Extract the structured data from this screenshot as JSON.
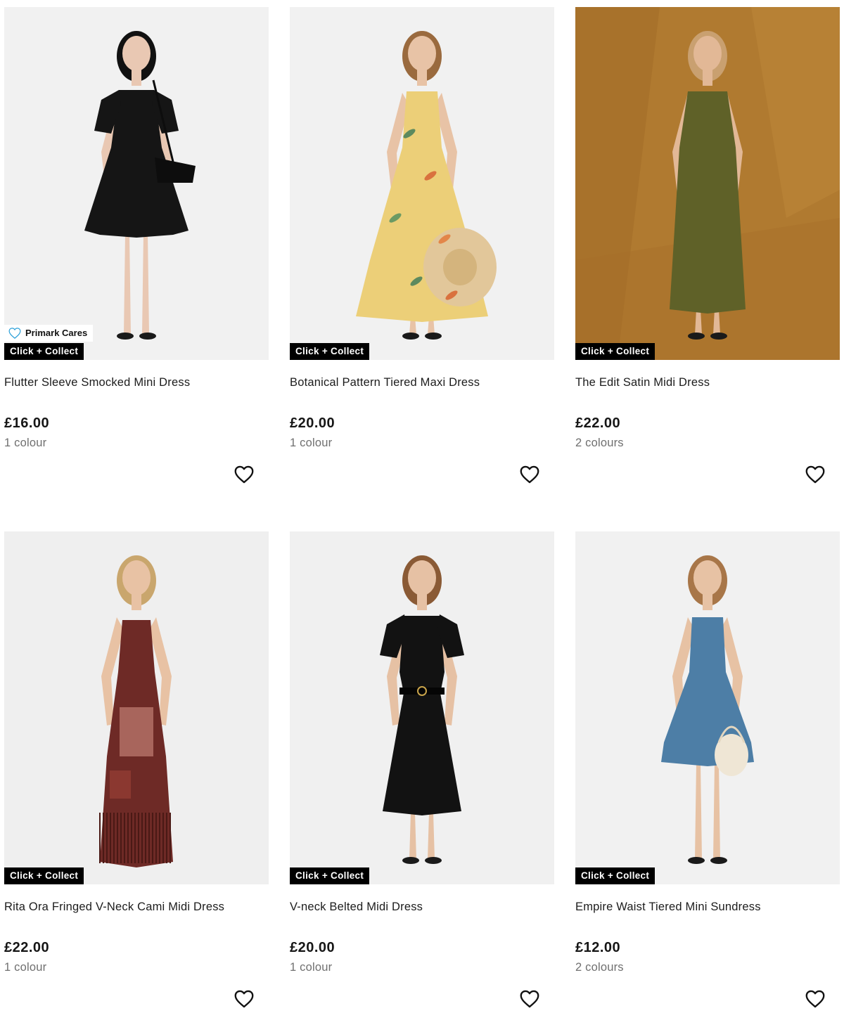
{
  "colors": {
    "badge_bg": "#000000",
    "badge_text": "#ffffff",
    "cares_icon": "#2a9fd8",
    "colour_count_text": "#6f6f6f"
  },
  "products": [
    {
      "name": "Flutter Sleeve Smocked Mini Dress",
      "price": "£16.00",
      "colours": "1 colour",
      "badge": "Click + Collect",
      "cares_badge": "Primark Cares",
      "image": {
        "bg": "#f1f1f1",
        "dress": "#151515",
        "skin": "#e9c8b3",
        "hair": "#111111",
        "style": "mini"
      }
    },
    {
      "name": "Botanical Pattern Tiered Maxi Dress",
      "price": "£20.00",
      "colours": "1 colour",
      "badge": "Click + Collect",
      "image": {
        "bg": "#f1f1f1",
        "dress": "#eccf78",
        "skin": "#e8c3a6",
        "hair": "#9a6a3e",
        "style": "maxi"
      }
    },
    {
      "name": "The Edit Satin Midi Dress",
      "price": "£22.00",
      "colours": "2 colours",
      "badge": "Click + Collect",
      "image": {
        "bg": "#b07a30",
        "dress": "#5f6128",
        "skin": "#e2b896",
        "hair": "#c9a070",
        "style": "midi"
      }
    },
    {
      "name": "Rita Ora Fringed V-Neck Cami Midi Dress",
      "price": "£22.00",
      "colours": "1 colour",
      "badge": "Click + Collect",
      "image": {
        "bg": "#efefef",
        "dress": "#6e2a26",
        "skin": "#e8c2a4",
        "hair": "#c9a66d",
        "style": "cami"
      }
    },
    {
      "name": "V-neck Belted Midi Dress",
      "price": "£20.00",
      "colours": "1 colour",
      "badge": "Click + Collect",
      "image": {
        "bg": "#f0f0f0",
        "dress": "#121212",
        "skin": "#e6c1a4",
        "hair": "#8a5a35",
        "style": "belted"
      }
    },
    {
      "name": "Empire Waist Tiered Mini Sundress",
      "price": "£12.00",
      "colours": "2 colours",
      "badge": "Click + Collect",
      "image": {
        "bg": "#f1f1f1",
        "dress": "#4d7ea6",
        "skin": "#e7c2a4",
        "hair": "#a87648",
        "style": "sundress"
      }
    }
  ]
}
